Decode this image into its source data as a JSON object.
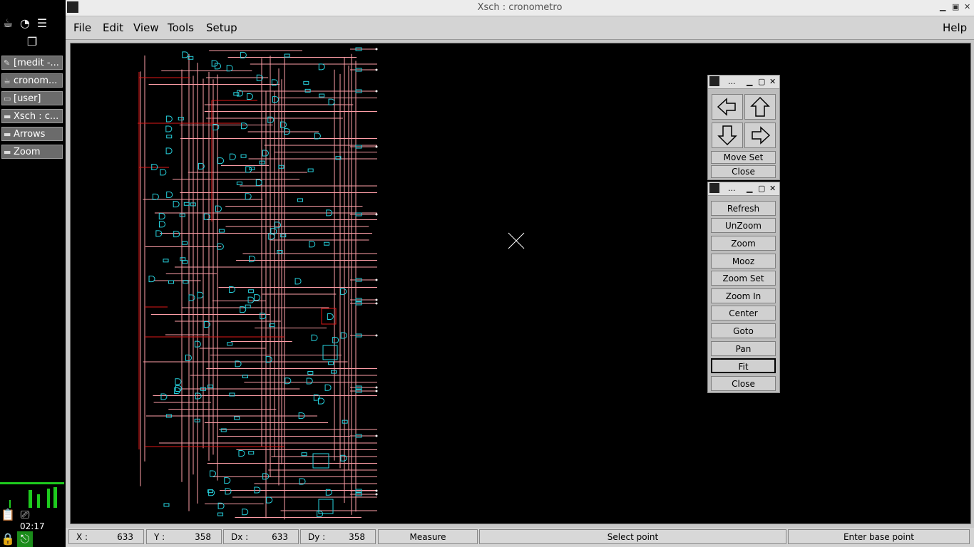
{
  "taskbar": {
    "tasks": [
      "[medit -...",
      "cronom...",
      "[user]",
      "Xsch : c...",
      "Arrows",
      "Zoom"
    ],
    "clock": "02:17"
  },
  "window": {
    "title": "Xsch : cronometro",
    "minimize": "▁",
    "maximize": "▣",
    "close": "✕"
  },
  "menu": {
    "file": "File",
    "edit": "Edit",
    "view": "View",
    "tools": "Tools",
    "setup": "Setup",
    "help": "Help"
  },
  "status": {
    "x_label": "X :",
    "x_value": "633",
    "y_label": "Y :",
    "y_value": "358",
    "dx_label": "Dx :",
    "dx_value": "633",
    "dy_label": "Dy :",
    "dy_value": "358",
    "mode": "Measure",
    "message": "Select point",
    "prompt": "Enter base point"
  },
  "arrows_palette": {
    "title": "...",
    "move_set": "Move Set",
    "close": "Close"
  },
  "zoom_palette": {
    "title": "...",
    "buttons": [
      "Refresh",
      "UnZoom",
      "Zoom",
      "Mooz",
      "Zoom Set",
      "Zoom In",
      "Center",
      "Goto",
      "Pan",
      "Fit",
      "Close"
    ],
    "active": "Fit"
  },
  "colors": {
    "wire": "#ff9fa8",
    "wire_highlight": "#e01818",
    "gate": "#27d4e0",
    "background": "#000000"
  }
}
